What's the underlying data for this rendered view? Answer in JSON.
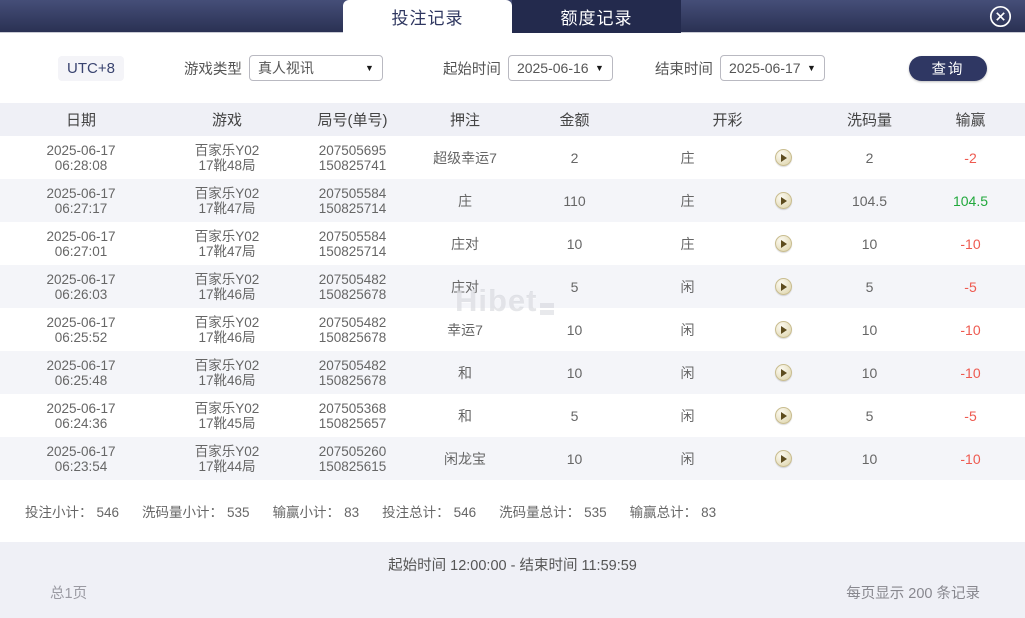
{
  "tabs": [
    {
      "label": "投注记录",
      "active": true
    },
    {
      "label": "额度记录",
      "active": false
    }
  ],
  "filters": {
    "timezone": "UTC+8",
    "game_type_label": "游戏类型",
    "game_type_value": "真人视讯",
    "start_label": "起始时间",
    "start_value": "2025-06-16",
    "end_label": "结束时间",
    "end_value": "2025-06-17",
    "query_button": "查询"
  },
  "table": {
    "columns": [
      "日期",
      "游戏",
      "局号(单号)",
      "押注",
      "金额",
      "开彩",
      "洗码量",
      "输赢"
    ],
    "rows": [
      {
        "date1": "2025-06-17",
        "date2": "06:28:08",
        "game1": "百家乐Y02",
        "game2": "17靴48局",
        "round1": "207505695",
        "round2": "150825741",
        "bet": "超级幸运7",
        "amount": "2",
        "result": "庄",
        "rolling": "2",
        "winloss": "-2"
      },
      {
        "date1": "2025-06-17",
        "date2": "06:27:17",
        "game1": "百家乐Y02",
        "game2": "17靴47局",
        "round1": "207505584",
        "round2": "150825714",
        "bet": "庄",
        "amount": "110",
        "result": "庄",
        "rolling": "104.5",
        "winloss": "104.5"
      },
      {
        "date1": "2025-06-17",
        "date2": "06:27:01",
        "game1": "百家乐Y02",
        "game2": "17靴47局",
        "round1": "207505584",
        "round2": "150825714",
        "bet": "庄对",
        "amount": "10",
        "result": "庄",
        "rolling": "10",
        "winloss": "-10"
      },
      {
        "date1": "2025-06-17",
        "date2": "06:26:03",
        "game1": "百家乐Y02",
        "game2": "17靴46局",
        "round1": "207505482",
        "round2": "150825678",
        "bet": "庄对",
        "amount": "5",
        "result": "闲",
        "rolling": "5",
        "winloss": "-5"
      },
      {
        "date1": "2025-06-17",
        "date2": "06:25:52",
        "game1": "百家乐Y02",
        "game2": "17靴46局",
        "round1": "207505482",
        "round2": "150825678",
        "bet": "幸运7",
        "amount": "10",
        "result": "闲",
        "rolling": "10",
        "winloss": "-10"
      },
      {
        "date1": "2025-06-17",
        "date2": "06:25:48",
        "game1": "百家乐Y02",
        "game2": "17靴46局",
        "round1": "207505482",
        "round2": "150825678",
        "bet": "和",
        "amount": "10",
        "result": "闲",
        "rolling": "10",
        "winloss": "-10"
      },
      {
        "date1": "2025-06-17",
        "date2": "06:24:36",
        "game1": "百家乐Y02",
        "game2": "17靴45局",
        "round1": "207505368",
        "round2": "150825657",
        "bet": "和",
        "amount": "5",
        "result": "闲",
        "rolling": "5",
        "winloss": "-5"
      },
      {
        "date1": "2025-06-17",
        "date2": "06:23:54",
        "game1": "百家乐Y02",
        "game2": "17靴44局",
        "round1": "207505260",
        "round2": "150825615",
        "bet": "闲龙宝",
        "amount": "10",
        "result": "闲",
        "rolling": "10",
        "winloss": "-10"
      }
    ]
  },
  "summary": {
    "items": [
      {
        "label": "投注小计：",
        "value": "546"
      },
      {
        "label": "洗码量小计：",
        "value": "535"
      },
      {
        "label": "输赢小计：",
        "value": "83"
      },
      {
        "label": "投注总计：",
        "value": "546"
      },
      {
        "label": "洗码量总计：",
        "value": "535"
      },
      {
        "label": "输赢总计：",
        "value": "83"
      }
    ]
  },
  "footer": {
    "time_range": "起始时间 12:00:00 - 结束时间 11:59:59",
    "total_pages": "总1页",
    "per_page": "每页显示 200 条记录"
  },
  "watermark": "Hibet",
  "colors": {
    "bar_navy_top": "#454e78",
    "bar_navy_bottom": "#2a3153",
    "inactive_tab": "#232a4d",
    "accent_navy": "#2f3763",
    "loss_red": "#ee5a50",
    "win_green": "#21a83c",
    "header_bg": "#eff0f6",
    "alt_row_bg": "#f4f5f9"
  }
}
